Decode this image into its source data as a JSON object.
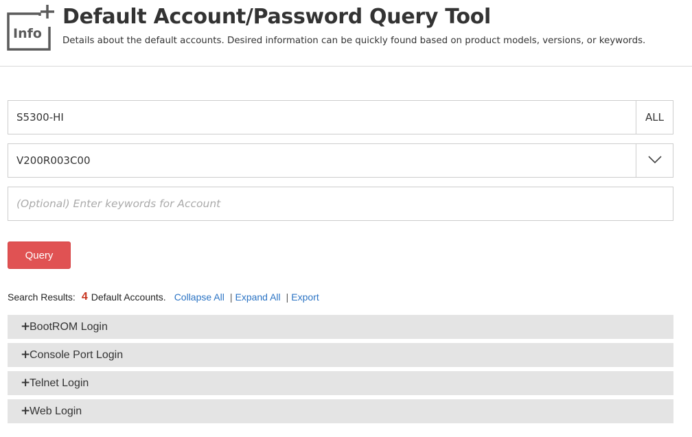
{
  "header": {
    "logo_text": "Info",
    "title": "Default Account/Password Query Tool",
    "subtitle": "Details about the default accounts. Desired information can be quickly found based on product models, versions, or keywords."
  },
  "form": {
    "model_value": "S5300-HI",
    "model_scope_label": "ALL",
    "version_value": "V200R003C00",
    "keyword_value": "",
    "keyword_placeholder": "(Optional) Enter keywords for Account",
    "query_label": "Query"
  },
  "results": {
    "prefix": "Search Results:",
    "count": "4",
    "suffix": "Default Accounts.",
    "collapse_all": "Collapse All",
    "expand_all": "Expand All",
    "export": "Export",
    "separator": "|"
  },
  "accordion": [
    {
      "label": "BootROM Login",
      "icon": "plus-icon"
    },
    {
      "label": "Console Port Login",
      "icon": "plus-icon"
    },
    {
      "label": "Telnet Login",
      "icon": "plus-icon"
    },
    {
      "label": "Web Login",
      "icon": "plus-icon"
    }
  ],
  "colors": {
    "accent": "#e05253",
    "count": "#c7331d",
    "link": "#2a73c4",
    "panel": "#e4e4e4"
  }
}
